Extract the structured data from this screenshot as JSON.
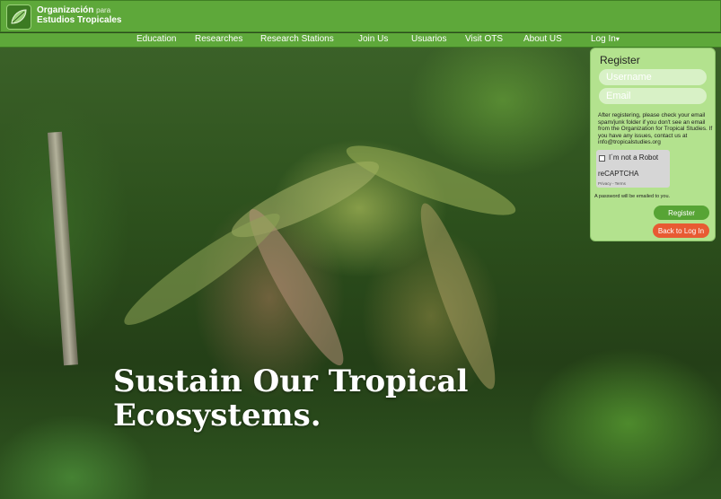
{
  "brand": {
    "line1_main": "Organización",
    "line1_small": "para",
    "line2": "Estudios Tropicales"
  },
  "nav": {
    "items": [
      "Education",
      "Researches",
      "Research Stations",
      "Join Us",
      "Usuarios",
      "Visit OTS",
      "About US"
    ],
    "login_label": "Log In",
    "login_caret": "▾"
  },
  "register": {
    "title": "Register",
    "username_placeholder": "Username",
    "email_placeholder": "Email",
    "note": "After registering, please check your email spam/junk folder if you don't see an email from the Organization for Tropical Studies. If you have any issues, contact us at info@tropicalstudies.org",
    "captcha_label": "I´m not a Robot",
    "captcha_brand": "reCAPTCHA",
    "captcha_terms": "Privacy - Terms",
    "password_note": "A password will be emailed to you.",
    "register_button": "Register",
    "back_button": "Back to Log In"
  },
  "hero": {
    "headline_line1": "Sustain Our Tropical",
    "headline_line2": "Ecosystems."
  },
  "colors": {
    "header_green": "#5ea83a",
    "panel_green": "#b3e28e",
    "register_button": "#57a435",
    "back_button": "#e85a33"
  },
  "icons": {
    "logo": "leaf-logo-icon",
    "login_caret": "chevron-down-icon"
  }
}
